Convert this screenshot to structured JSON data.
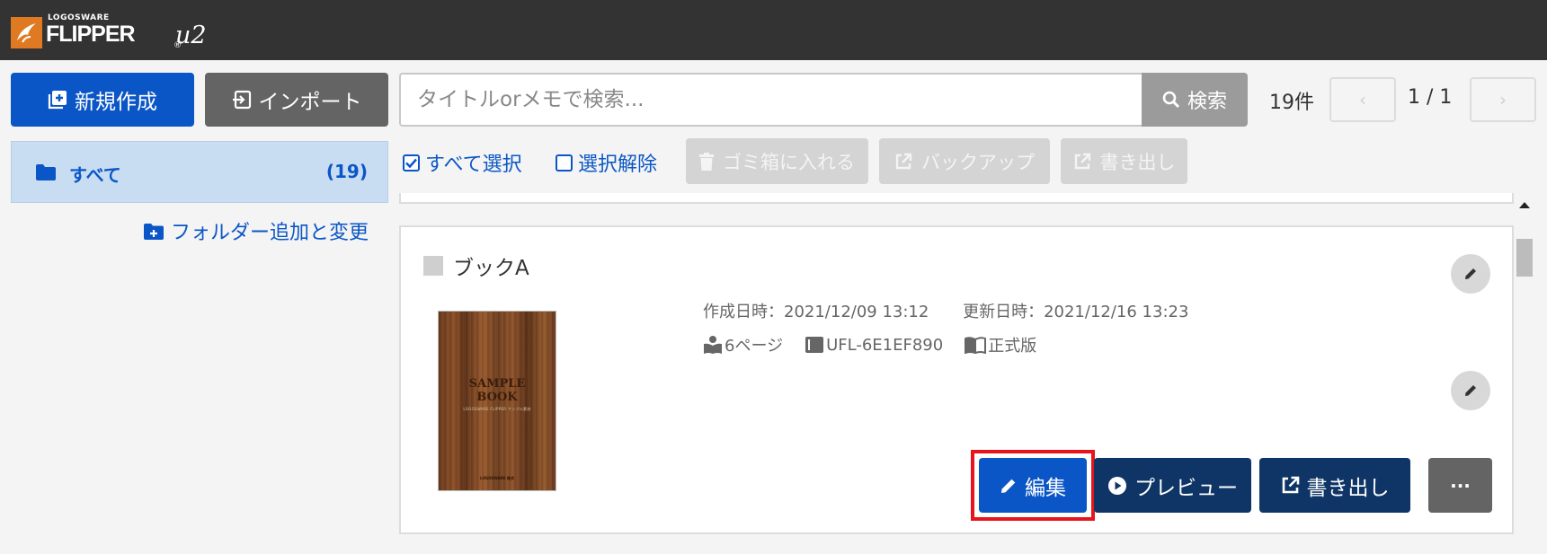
{
  "header": {
    "brand_small": "LOGOSWARE",
    "brand_name": "FLIPPER",
    "brand_reg": "®",
    "brand_version": "u2",
    "logo_icon": "bird-logo-icon"
  },
  "toolbar": {
    "new_label": "新規作成",
    "import_label": "インポート",
    "search_placeholder": "タイトルorメモで検索...",
    "search_value": "",
    "search_label": "検索",
    "count": "19件",
    "page_indicator": "1 / 1",
    "prev_symbol": "‹",
    "next_symbol": "›"
  },
  "sidebar": {
    "folders": [
      {
        "label": "すべて",
        "count": "(19)",
        "selected": true
      }
    ],
    "add_folder_label": "フォルダー追加と変更"
  },
  "bulk": {
    "select_all": "すべて選択",
    "deselect": "選択解除",
    "trash": "ゴミ箱に入れる",
    "backup": "バックアップ",
    "export": "書き出し"
  },
  "books": [
    {
      "title": "ブックA",
      "cover": {
        "title": "SAMPLE\nBOOK",
        "subtitle": "LOGOSWARE FLIPPER サンプル素材",
        "footer": "LOGOSWARE 株式"
      },
      "created": "作成日時：2021/12/09 13:12",
      "updated": "更新日時：2021/12/16 13:23",
      "pages": "6ページ",
      "code": "UFL-6E1EF890",
      "edition": "正式版",
      "actions": {
        "edit": "編集",
        "preview": "プレビュー",
        "export": "書き出し",
        "more": "···"
      }
    }
  ],
  "colors": {
    "primary": "#0b56c6",
    "dark_navy": "#0f3566",
    "gray_button": "#646464",
    "header_bg": "#333333",
    "logo_orange": "#e07a22",
    "highlight_red": "#e8141b",
    "selected_folder_bg": "#c8ddf2"
  }
}
